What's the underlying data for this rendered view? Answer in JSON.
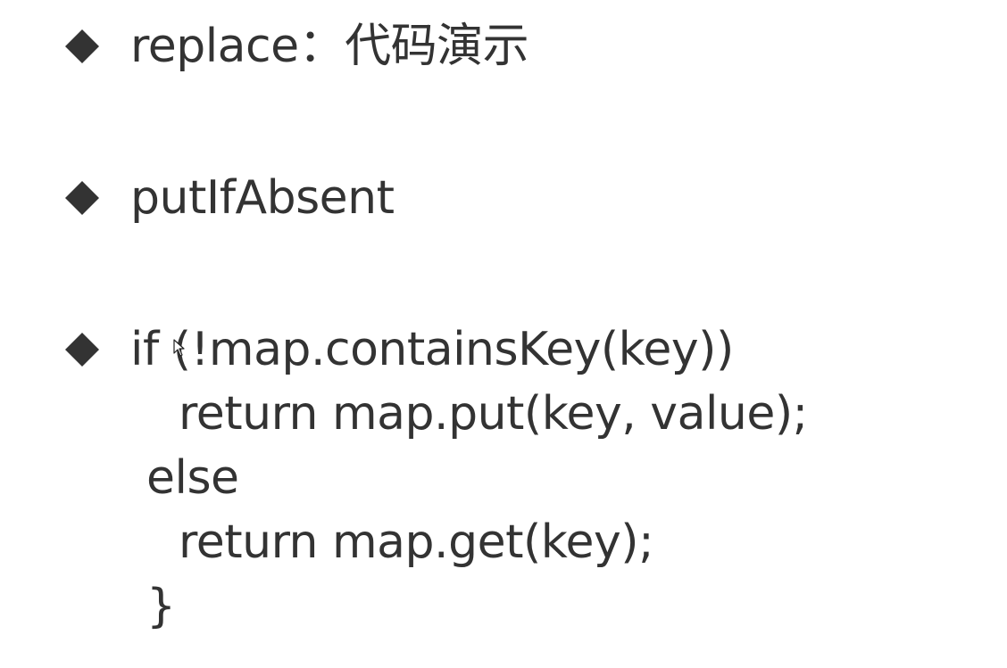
{
  "bullets": [
    {
      "text": "replace：代码演示",
      "icon": "diamond-bullet-icon"
    },
    {
      "text": "putIfAbsent",
      "icon": "diamond-bullet-icon"
    },
    {
      "icon": "diamond-bullet-icon"
    }
  ],
  "code": {
    "lines": [
      "if (!map.containsKey(key))",
      "return map.put(key, value);",
      "else",
      "return map.get(key);",
      "}"
    ]
  },
  "colors": {
    "text": "#333333",
    "bullet": "#333333",
    "background": "#ffffff"
  },
  "cursor": {
    "icon": "mouse-pointer-icon"
  }
}
